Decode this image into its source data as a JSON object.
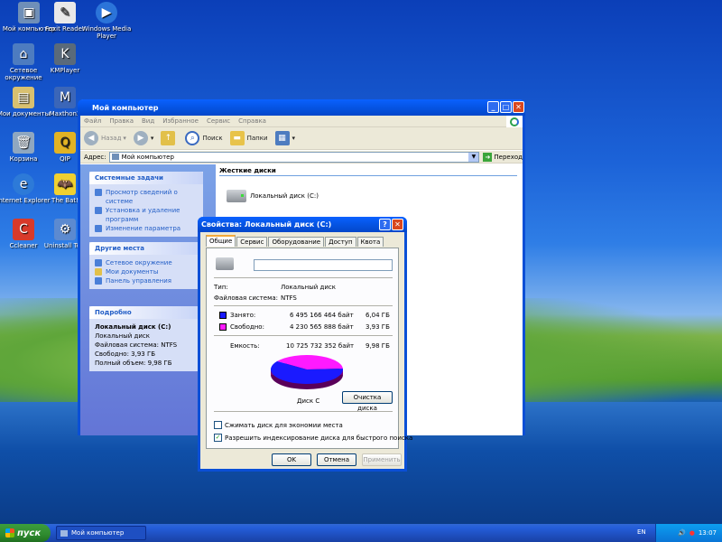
{
  "desktop": {
    "icons": [
      {
        "label": "Мой компьютер"
      },
      {
        "label": "Foxit Reader"
      },
      {
        "label": "Windows Media Player"
      },
      {
        "label": "Сетевое окружение"
      },
      {
        "label": "KMPlayer"
      },
      {
        "label": "Мои документы"
      },
      {
        "label": "Maxthon2"
      },
      {
        "label": "Корзина"
      },
      {
        "label": "QIP"
      },
      {
        "label": "Internet Explorer"
      },
      {
        "label": "The Bat!"
      },
      {
        "label": "Ccleaner"
      },
      {
        "label": "Uninstall Tool"
      }
    ]
  },
  "explorer": {
    "title": "Мой компьютер",
    "menu": [
      "Файл",
      "Правка",
      "Вид",
      "Избранное",
      "Сервис",
      "Справка"
    ],
    "toolbar": {
      "back": "Назад",
      "search": "Поиск",
      "folders": "Папки"
    },
    "address": {
      "label": "Адрес:",
      "value": "Мой компьютер",
      "go": "Переход"
    },
    "tasks": {
      "header": "Системные задачи",
      "items": [
        "Просмотр сведений о системе",
        "Установка и удаление программ",
        "Изменение параметра"
      ]
    },
    "places": {
      "header": "Другие места",
      "items": [
        "Сетевое окружение",
        "Мои документы",
        "Панель управления"
      ]
    },
    "details": {
      "header": "Подробно",
      "name": "Локальный диск (C:)",
      "type": "Локальный диск",
      "fs": "Файловая система: NTFS",
      "free": "Свободно: 3,93 ГБ",
      "total": "Полный объем: 9,98 ГБ"
    },
    "section": "Жесткие диски",
    "drive": "Локальный диск (C:)"
  },
  "dialog": {
    "title": "Свойства: Локальный диск (C:)",
    "tabs": [
      "Общие",
      "Сервис",
      "Оборудование",
      "Доступ",
      "Квота"
    ],
    "type_label": "Тип:",
    "type_value": "Локальный диск",
    "fs_label": "Файловая система:",
    "fs_value": "NTFS",
    "used": {
      "label": "Занято:",
      "bytes": "6 495 166 464 байт",
      "size": "6,04 ГБ",
      "color": "#1a1aff"
    },
    "free": {
      "label": "Свободно:",
      "bytes": "4 230 565 888 байт",
      "size": "3,93 ГБ",
      "color": "#ff1aff"
    },
    "capacity": {
      "label": "Емкость:",
      "bytes": "10 725 732 352 байт",
      "size": "9,98 ГБ"
    },
    "used_fraction": 0.606,
    "disk_label": "Диск C",
    "cleanup": "Очистка диска",
    "compress": "Сжимать диск для экономии места",
    "index": "Разрешить индексирование диска для быстрого поиска",
    "ok": "OK",
    "cancel": "Отмена",
    "apply": "Применить"
  },
  "taskbar": {
    "start": "пуск",
    "item": "Мой компьютер",
    "lang": "EN",
    "time": "13:07"
  }
}
